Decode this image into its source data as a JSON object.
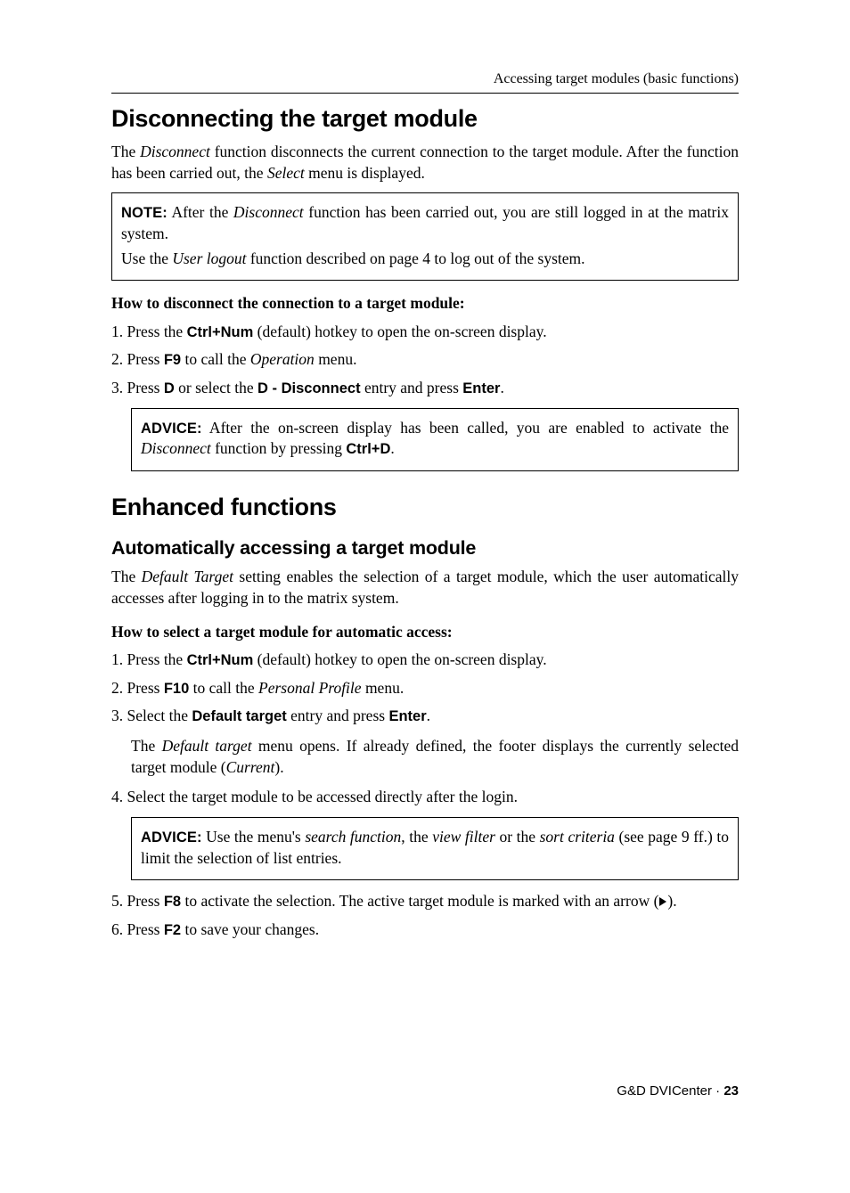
{
  "running_head": "Accessing target modules (basic functions)",
  "section1": {
    "title": "Disconnecting the target module",
    "intro_parts": [
      "The ",
      "Disconnect",
      " function disconnects the current connection to the target module. After the function has been carried out, the ",
      "Select",
      " menu is displayed."
    ],
    "note": {
      "label": "NOTE:",
      "line1_parts": [
        " After the ",
        "Disconnect",
        " function has been carried out, you are still logged in at the matrix system."
      ],
      "line2_parts": [
        "Use the ",
        "User logout",
        " function described on page 4 to log out of the system."
      ]
    },
    "howto": "How to disconnect the connection to a target module:",
    "steps": {
      "s1": {
        "num": "1.",
        "pre": "  Press the ",
        "key": "Ctrl+Num",
        "post": " (default) hotkey to open the on-screen display."
      },
      "s2": {
        "num": "2.",
        "pre": "  Press ",
        "key": "F9",
        "mid": " to call the ",
        "ital": "Operation",
        "post": " menu."
      },
      "s3": {
        "num": "3.",
        "pre": "  Press ",
        "key1": "D",
        "mid1": " or select the ",
        "key2": "D - Disconnect",
        "mid2": " entry and press ",
        "key3": "Enter",
        "post": "."
      }
    },
    "advice": {
      "label": "ADVICE:",
      "parts": [
        " After the on-screen display has been called, you are enabled to activate the ",
        "Disconnect",
        " function by pressing ",
        "Ctrl+D",
        "."
      ]
    }
  },
  "section2": {
    "title": "Enhanced functions",
    "sub": "Automatically accessing a target module",
    "intro_parts": [
      "The ",
      "Default Target",
      " setting enables the selection of a target module, which the user automatically accesses after logging in to the matrix system."
    ],
    "howto": "How to select a target module for automatic access:",
    "steps": {
      "s1": {
        "num": "1.",
        "pre": "  Press the ",
        "key": "Ctrl+Num",
        "post": " (default) hotkey to open the on-screen display."
      },
      "s2": {
        "num": "2.",
        "pre": "  Press ",
        "key": "F10",
        "mid": " to call the ",
        "ital": "Personal Profile",
        "post": " menu."
      },
      "s3": {
        "num": "3.",
        "pre": "  Select the ",
        "key1": "Default target",
        "mid": " entry and press ",
        "key2": "Enter",
        "post": "."
      },
      "s3_sub_parts": [
        "The ",
        "Default target",
        " menu opens. If already defined, the footer displays the currently selected target module (",
        "Current",
        ")."
      ],
      "s4": {
        "num": "4.",
        "text": "  Select the target module to be accessed directly after the login."
      },
      "advice": {
        "label": "ADVICE:",
        "parts": [
          " Use the menu's ",
          "search function",
          ", the ",
          "view filter",
          " or the ",
          "sort criteria",
          " (see page 9 ff.) to limit the selection of list entries."
        ]
      },
      "s5": {
        "num": "5.",
        "pre": "  Press ",
        "key": "F8",
        "post_a": " to activate the selection. The active target module is marked with an arrow (",
        "post_b": ")."
      },
      "s6": {
        "num": "6.",
        "pre": "  Press ",
        "key": "F2",
        "post": " to save your changes."
      }
    }
  },
  "footer": {
    "text": "G&D DVICenter · ",
    "page": "23"
  }
}
